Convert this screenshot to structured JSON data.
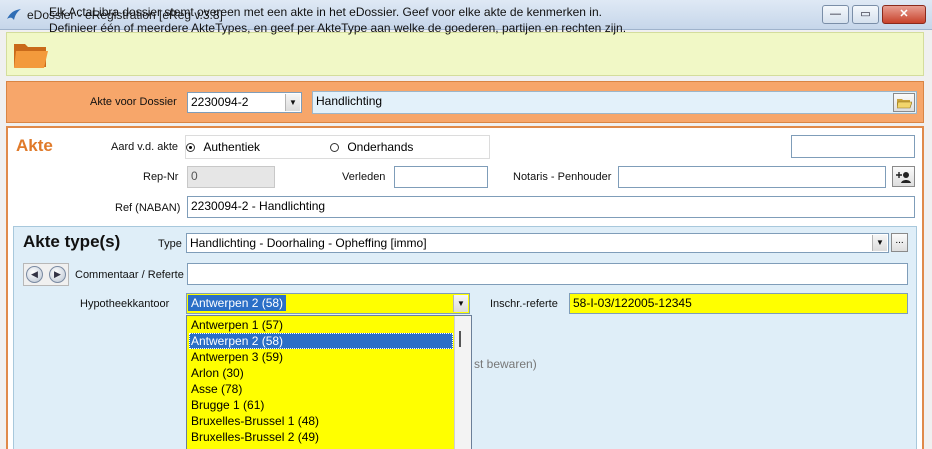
{
  "window": {
    "title": "eDossier - eRegistration [eReg v.3.8]",
    "min_glyph": "—",
    "max_glyph": "▭",
    "close_glyph": "✕"
  },
  "info": {
    "line1": "Elk ActaLibra dossier stemt overeen met een akte in het eDossier. Geef voor elke akte de kenmerken in.",
    "line2": "Definieer één of meerdere AkteTypes, en geef per AkteType aan welke de goederen, partijen en rechten zijn."
  },
  "dossier": {
    "label": "Akte voor Dossier",
    "number": "2230094-2",
    "description": "Handlichting"
  },
  "akte": {
    "title": "Akte",
    "aard_label": "Aard v.d. akte",
    "options": [
      "Authentiek",
      "Onderhands"
    ],
    "selected_option": "Authentiek",
    "repnr_label": "Rep-Nr",
    "repnr_value": "0",
    "verleden_label": "Verleden",
    "verleden_value": "",
    "notaris_label": "Notaris - Penhouder",
    "notaris_value": "",
    "ref_label": "Ref (NABAN)",
    "ref_value": "2230094-2 - Handlichting"
  },
  "types": {
    "title": "Akte type(s)",
    "type_label": "Type",
    "type_value": "Handlichting - Doorhaling - Opheffing [immo]",
    "ellipsis": "...",
    "commentaar_label": "Commentaar / Referte",
    "commentaar_value": "",
    "hypo_label": "Hypotheekkantoor",
    "hypo_value": "Antwerpen 2 (58)",
    "inschr_label": "Inschr.-referte",
    "inschr_value": "58-I-03/122005-12345",
    "hidden_fragment": "st bewaren)"
  },
  "dropdown": {
    "items": [
      "Antwerpen 1 (57)",
      "Antwerpen 2 (58)",
      "Antwerpen 3 (59)",
      "Arlon (30)",
      "Asse (78)",
      "Brugge 1 (61)",
      "Bruxelles-Brussel 1 (48)",
      "Bruxelles-Brussel 2 (49)"
    ],
    "selected_index": 1
  },
  "colors": {
    "banner": "#f1f8c6",
    "dossier_bar": "#f7a66a",
    "accent_orange": "#e07a2a",
    "types_panel": "#dfeef8",
    "highlight_yellow": "#ffff00",
    "selection_blue": "#2b6fc7"
  }
}
